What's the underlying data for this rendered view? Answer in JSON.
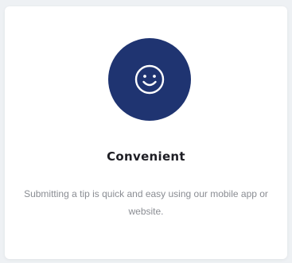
{
  "feature_card": {
    "icon": "smiley-face-icon",
    "icon_bg_color": "#1f3471",
    "title": "Convenient",
    "description": "Submitting a tip is quick and easy using our mobile app or website."
  }
}
